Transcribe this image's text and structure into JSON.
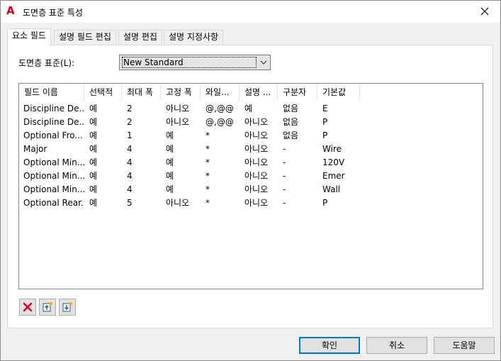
{
  "window": {
    "title": "도면층 표준 특성",
    "app_icon_glyph": "A",
    "app_icon_color": "#d6001c"
  },
  "tabs": [
    {
      "label": "요소 필드",
      "active": true
    },
    {
      "label": "설명 필드 편집",
      "active": false
    },
    {
      "label": "설명 편집",
      "active": false
    },
    {
      "label": "설명 지정사항",
      "active": false
    }
  ],
  "standard": {
    "label": "도면층 표준(L):",
    "selected": "New Standard"
  },
  "table": {
    "columns": [
      "필드 이름",
      "선택적",
      "최대 폭",
      "고정 폭",
      "와일...",
      "설명 ...",
      "구분자",
      "기본값"
    ],
    "rows": [
      [
        "Discipline De...",
        "예",
        "2",
        "아니오",
        "@,@@",
        "예",
        "없음",
        "E"
      ],
      [
        "Discipline De...",
        "예",
        "2",
        "아니오",
        "@,@@",
        "아니오",
        "없음",
        "P"
      ],
      [
        "Optional Fro...",
        "예",
        "1",
        "예",
        "*",
        "아니오",
        "없음",
        "P"
      ],
      [
        "Major",
        "예",
        "4",
        "예",
        "*",
        "아니오",
        "-",
        "Wire"
      ],
      [
        "Optional Min...",
        "예",
        "4",
        "예",
        "*",
        "아니오",
        "-",
        "120V"
      ],
      [
        "Optional Min...",
        "예",
        "4",
        "예",
        "*",
        "아니오",
        "-",
        "Emer"
      ],
      [
        "Optional Min...",
        "예",
        "4",
        "예",
        "*",
        "아니오",
        "-",
        "Wall"
      ],
      [
        "Optional Rear...",
        "예",
        "5",
        "아니오",
        "*",
        "아니오",
        "-",
        "P"
      ]
    ]
  },
  "toolbar": {
    "icons": [
      "delete-icon",
      "insert-before-icon",
      "insert-after-icon"
    ]
  },
  "buttons": {
    "ok": "확인",
    "cancel": "취소",
    "help": "도움말"
  },
  "colors": {
    "accent": "#0078d7",
    "delete_red": "#d6001c"
  }
}
